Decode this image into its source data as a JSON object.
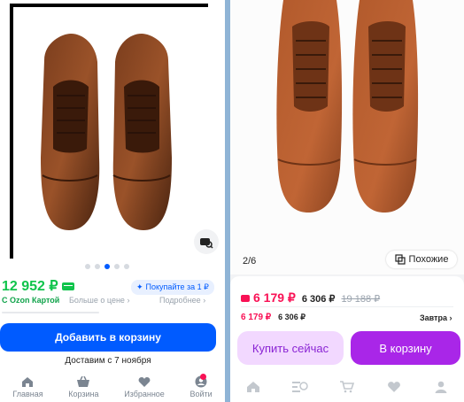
{
  "left": {
    "price": "12 952 ₽",
    "buy_in_parts": "Покупайте за 1 ₽",
    "ozon_card": "С Ozon Картой",
    "more_less": "Больше о цене",
    "details": "Подробнее",
    "add_to_cart": "Добавить в корзину",
    "delivery": "Доставим с 7 ноября",
    "image_dots": {
      "total": 5,
      "active_index": 2
    },
    "nav": [
      {
        "label": "Главная",
        "icon": "home-icon"
      },
      {
        "label": "Корзина",
        "icon": "basket-icon"
      },
      {
        "label": "Избранное",
        "icon": "heart-icon"
      },
      {
        "label": "Войти",
        "icon": "login-icon"
      }
    ]
  },
  "right": {
    "image_counter": "2/6",
    "similar": "Похожие",
    "price_main": "6 179 ₽",
    "price_ozon": "6 306 ₽",
    "price_old": "19 188 ₽",
    "price2_main": "6 179 ₽",
    "price2_ozon": "6 306 ₽",
    "delivery": "Завтра",
    "buy_now": "Купить сейчас",
    "to_cart": "В корзину",
    "nav_icons": [
      "home-icon",
      "catalog-icon",
      "cart-icon",
      "heart-icon",
      "profile-icon"
    ]
  },
  "colors": {
    "ozon_blue": "#005bff",
    "green": "#10c44c",
    "pink": "#f91155",
    "purple": "#a926e8",
    "brown": "#b25a2c"
  }
}
